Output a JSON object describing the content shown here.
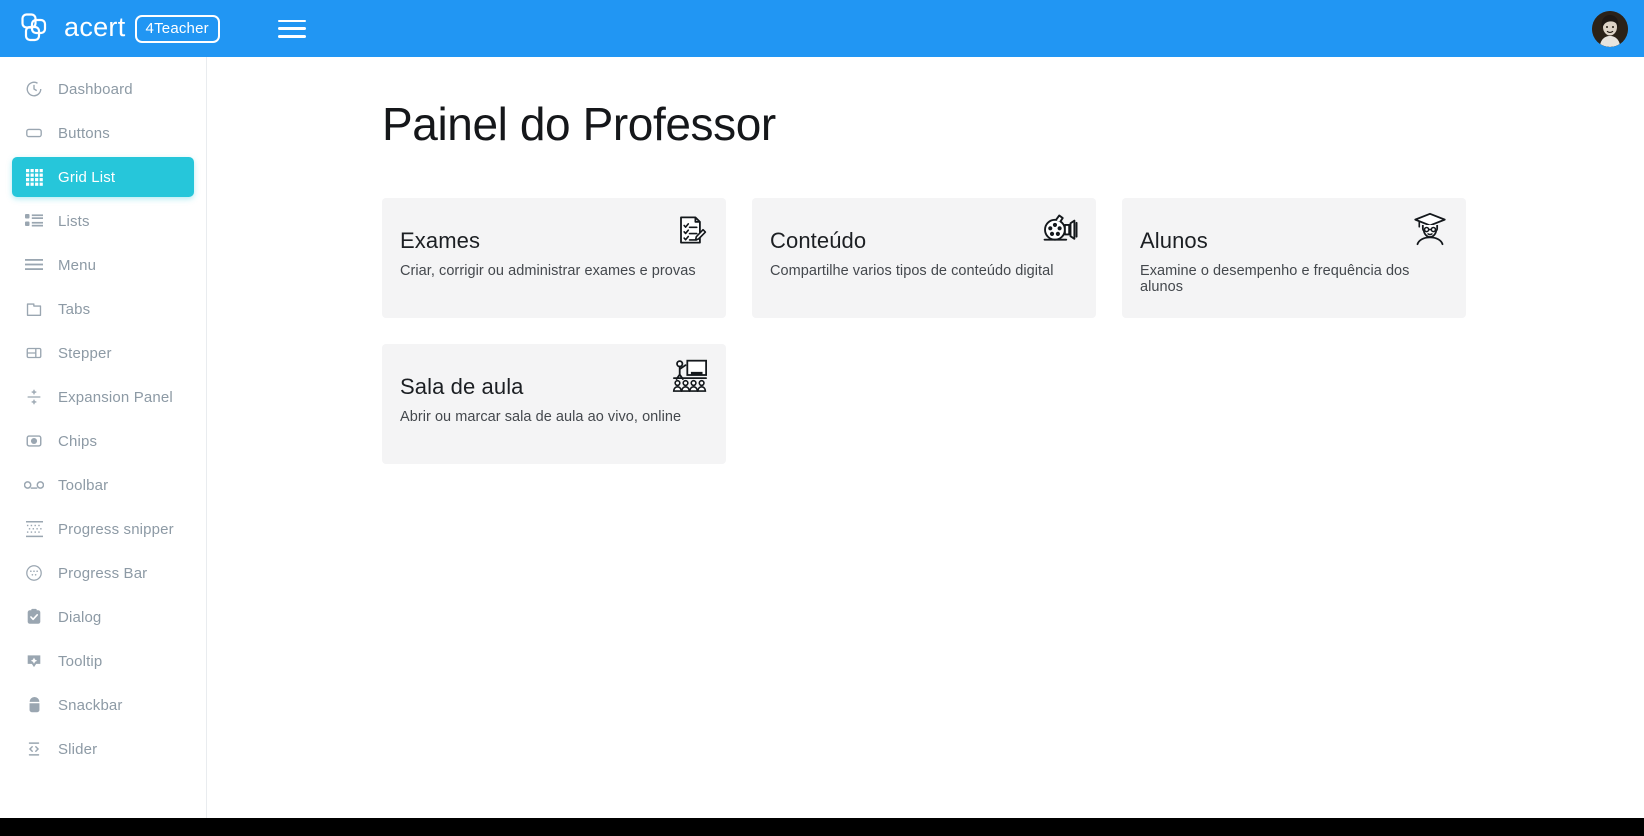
{
  "topbar": {
    "brand_name": "acert",
    "brand_badge": "4Teacher",
    "menu_icon": "hamburger-icon",
    "avatar_alt": "user-avatar"
  },
  "sidebar": {
    "items": [
      {
        "label": "Dashboard",
        "icon": "clock-icon",
        "active": false
      },
      {
        "label": "Buttons",
        "icon": "button-icon",
        "active": false
      },
      {
        "label": "Grid List",
        "icon": "grid-icon",
        "active": true
      },
      {
        "label": "Lists",
        "icon": "list-icon",
        "active": false
      },
      {
        "label": "Menu",
        "icon": "menu-lines-icon",
        "active": false
      },
      {
        "label": "Tabs",
        "icon": "tabs-icon",
        "active": false
      },
      {
        "label": "Stepper",
        "icon": "stepper-icon",
        "active": false
      },
      {
        "label": "Expansion Panel",
        "icon": "expand-collapse-icon",
        "active": false
      },
      {
        "label": "Chips",
        "icon": "chip-icon",
        "active": false
      },
      {
        "label": "Toolbar",
        "icon": "toolbar-icon",
        "active": false
      },
      {
        "label": "Progress snipper",
        "icon": "dots-grid-icon",
        "active": false
      },
      {
        "label": "Progress Bar",
        "icon": "circle-dots-icon",
        "active": false
      },
      {
        "label": "Dialog",
        "icon": "dialog-check-icon",
        "active": false
      },
      {
        "label": "Tooltip",
        "icon": "tooltip-icon",
        "active": false
      },
      {
        "label": "Snackbar",
        "icon": "snackbar-icon",
        "active": false
      },
      {
        "label": "Slider",
        "icon": "slider-icon",
        "active": false
      }
    ]
  },
  "main": {
    "page_title": "Painel do Professor",
    "cards": [
      {
        "title": "Exames",
        "desc": "Criar, corrigir ou administrar exames e provas",
        "icon": "checklist-clipboard-icon"
      },
      {
        "title": "Conteúdo",
        "desc": "Compartilhe varios tipos de conteúdo digital",
        "icon": "film-projector-icon"
      },
      {
        "title": "Alunos",
        "desc": "Examine o desempenho e frequência dos alunos",
        "icon": "graduate-student-icon"
      },
      {
        "title": "Sala de aula",
        "desc": "Abrir ou marcar sala de aula ao vivo, online",
        "icon": "classroom-teacher-icon"
      }
    ]
  },
  "colors": {
    "topbar_blue": "#2196f3",
    "active_cyan": "#26c6da",
    "card_bg": "#f4f4f5",
    "nav_text": "#8d9aa5",
    "page_bg": "#ffffff"
  }
}
